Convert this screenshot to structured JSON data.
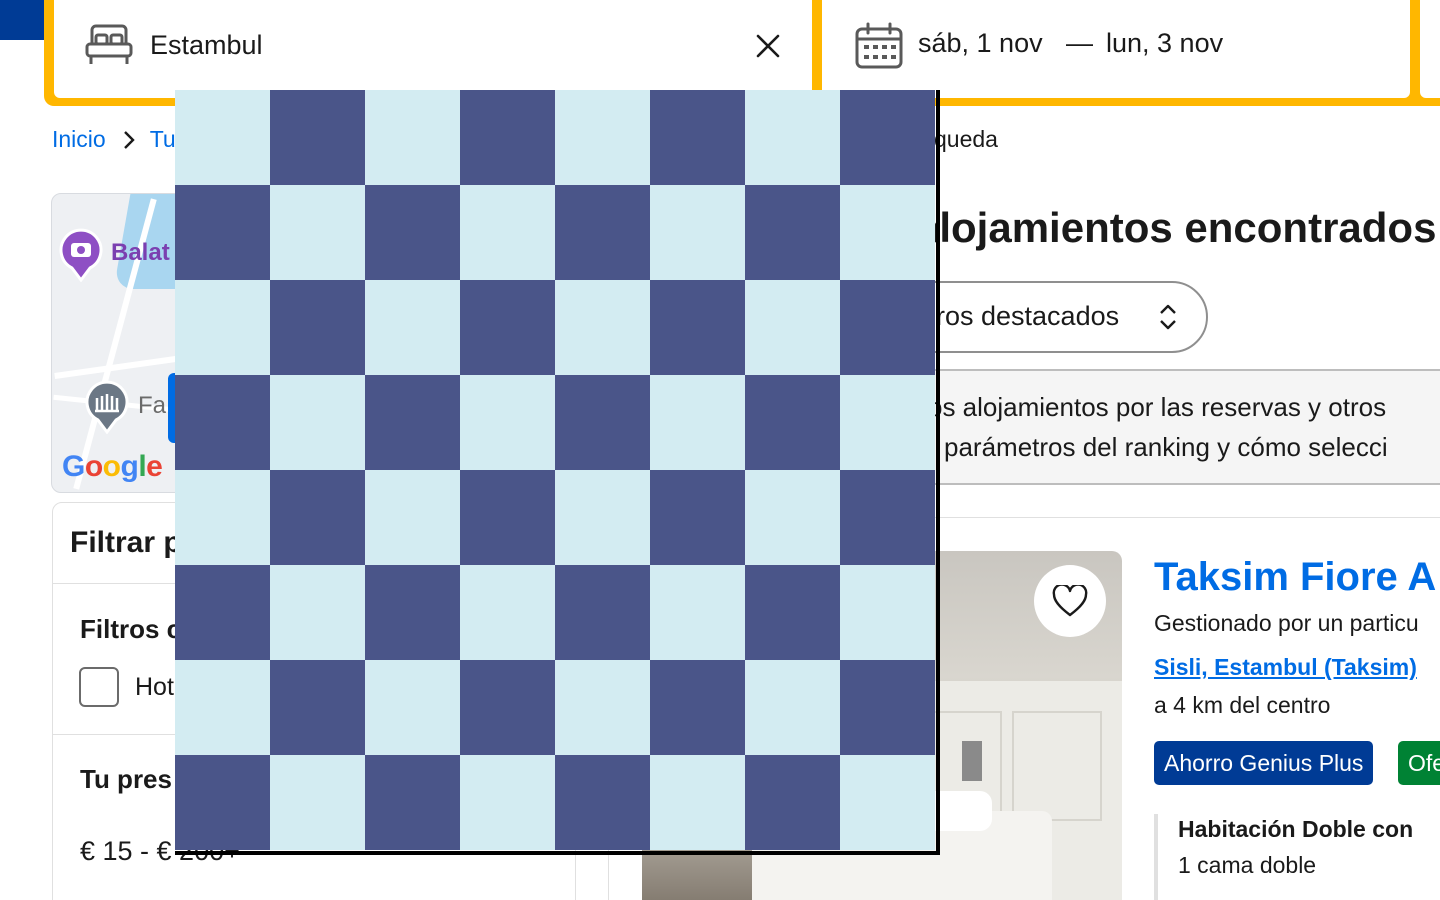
{
  "search": {
    "destination": "Estambul",
    "date_start": "sáb, 1 nov",
    "date_separator": "—",
    "date_end": "lun, 3 nov"
  },
  "breadcrumb": {
    "home": "Inicio",
    "second": "Tu",
    "current": "queda"
  },
  "map": {
    "label_balat": "Balat",
    "label_fa": "Fa",
    "logo_letters": [
      "G",
      "o",
      "o",
      "g",
      "l",
      "e"
    ]
  },
  "filters": {
    "title": "Filtrar p",
    "group_title": "Filtros c",
    "option_label": "Hot",
    "budget_title": "Tu pres",
    "budget_range": "€ 15 - € 200+"
  },
  "results": {
    "heading": "alojamientos encontrados",
    "sort_label": "ros destacados",
    "notice_line1": "os alojamientos por las reservas y otros",
    "notice_line2": "parámetros del ranking y cómo selecci"
  },
  "property": {
    "title": "Taksim Fiore A",
    "managed_by": "Gestionado por un particu",
    "location": "Sisli, Estambul (Taksim)",
    "distance": "a 4 km del centro",
    "badge_genius": "Ahorro Genius Plus",
    "badge_offer": "Ofe",
    "room_name": "Habitación Doble con",
    "room_bed": "1 cama doble"
  },
  "overlay": {
    "rows": 8,
    "cols": 8,
    "light_color": "#d3ecf2",
    "dark_color": "#4a5589"
  },
  "colors": {
    "brand_blue": "#003b95",
    "link_blue": "#006ce4",
    "search_yellow": "#ffb700",
    "offer_green": "#008234"
  }
}
